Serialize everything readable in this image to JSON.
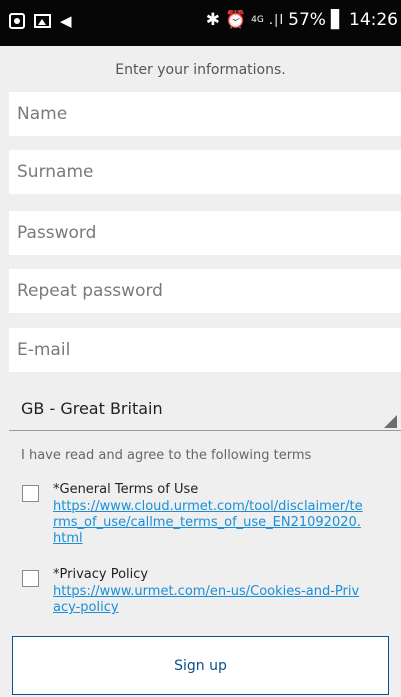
{
  "status_bar": {
    "left_icons": [
      "notification-icon",
      "image-icon",
      "send-icon"
    ],
    "bluetooth": "✱",
    "alarm": "⏰",
    "network": "4G",
    "signal": ".∣l",
    "battery": "57%",
    "battery_icon": "▋",
    "time": "14:26"
  },
  "form": {
    "hint": "Enter your informations.",
    "name_placeholder": "Name",
    "surname_placeholder": "Surname",
    "password_placeholder": "Password",
    "repeat_password_placeholder": "Repeat password",
    "email_placeholder": "E-mail",
    "country": "GB - Great Britain"
  },
  "terms": {
    "intro": "I have read and agree to the following terms",
    "items": [
      {
        "title": "*General Terms of Use",
        "link": "https://www.cloud.urmet.com/tool/disclaimer/terms_of_use/callme_terms_of_use_EN21092020.html"
      },
      {
        "title": "*Privacy Policy",
        "link": "https://www.urmet.com/en-us/Cookies-and-Privacy-policy"
      }
    ]
  },
  "signup_label": "Sign up",
  "colors": {
    "background": "#efefef",
    "status_bar": "#060606",
    "link": "#1a8fd8",
    "button_border": "#0b4f8c"
  }
}
